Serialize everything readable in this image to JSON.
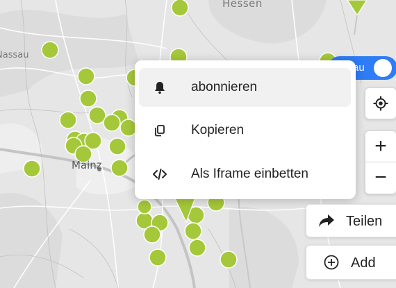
{
  "map": {
    "labels": {
      "hessen": "Hessen",
      "nassau": "Nassau",
      "mainz": "Mainz"
    },
    "marker_color": "#a5c83a",
    "route_marker_color": "#a5c83a"
  },
  "menu": {
    "items": [
      {
        "label": "abonnieren",
        "icon": "bell-icon",
        "highlighted": true
      },
      {
        "label": "Kopieren",
        "icon": "copy-icon",
        "highlighted": false
      },
      {
        "label": "Als Iframe einbetten",
        "icon": "code-icon",
        "highlighted": false
      }
    ]
  },
  "toggle": {
    "label_visible": "au",
    "on": true,
    "color": "#2e7cf6"
  },
  "controls": {
    "locate_icon": "locate-icon",
    "zoom_in": "+",
    "zoom_out": "−"
  },
  "actions": {
    "share_label": "Teilen",
    "share_icon": "share-arrow-icon",
    "add_label": "Add",
    "add_icon": "plus-circle-icon"
  }
}
